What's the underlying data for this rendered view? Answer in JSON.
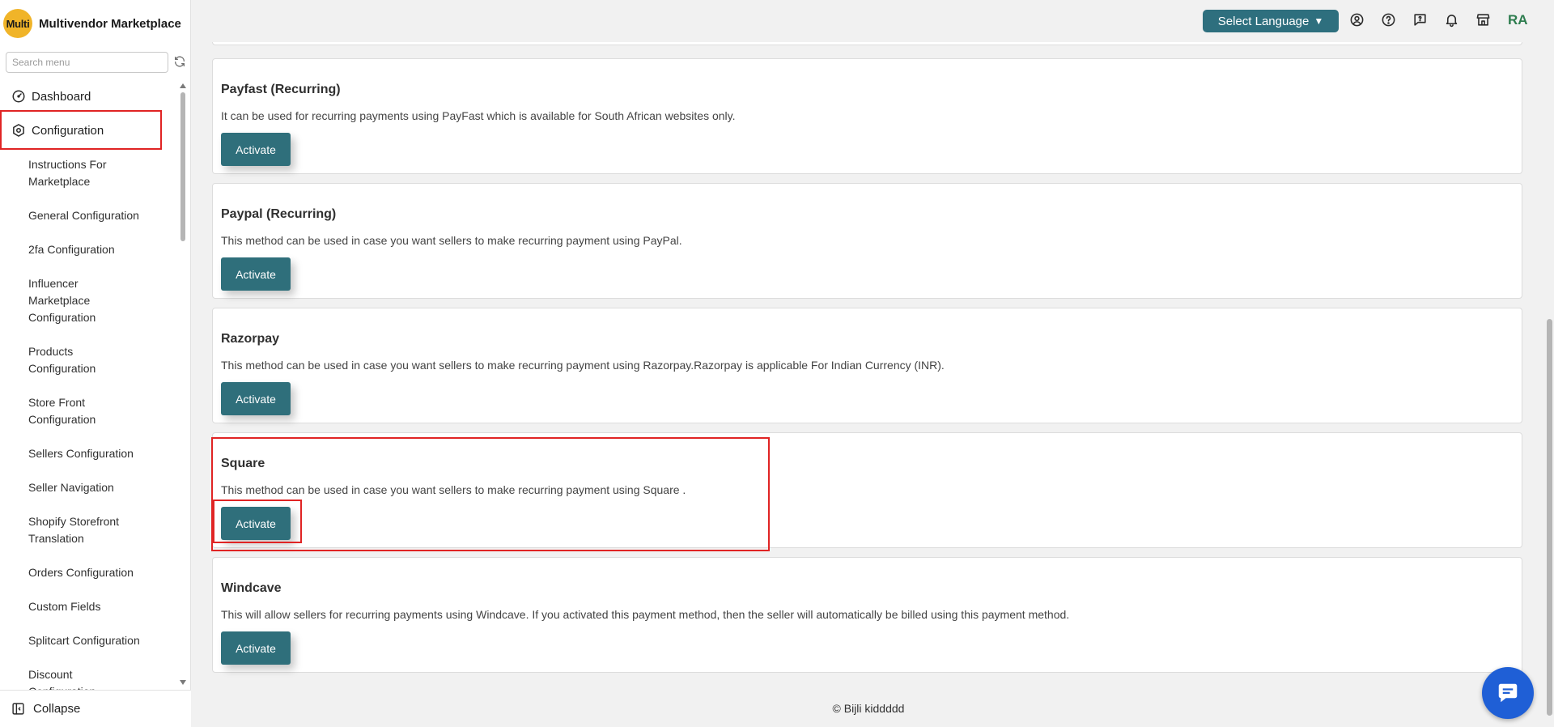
{
  "brand": {
    "logo_text": "Multi",
    "name": "Multivendor Marketplace"
  },
  "search": {
    "placeholder": "Search menu"
  },
  "nav": {
    "dashboard": "Dashboard",
    "configuration": "Configuration",
    "sub_items": [
      "Instructions For Marketplace",
      "General Configuration",
      "2fa Configuration",
      "Influencer Marketplace Configuration",
      "Products Configuration",
      "Store Front Configuration",
      "Sellers Configuration",
      "Seller Navigation",
      "Shopify Storefront Translation",
      "Orders Configuration",
      "Custom Fields",
      "Splitcart Configuration",
      "Discount Configuration"
    ],
    "collapse": "Collapse"
  },
  "topbar": {
    "language_button": "Select Language",
    "avatar": "RA",
    "icons": [
      "user-circle-icon",
      "help-circle-icon",
      "feedback-icon",
      "bell-icon",
      "store-icon"
    ]
  },
  "cards": [
    {
      "title": "Payfast (Recurring)",
      "description": "It can be used for recurring payments using PayFast which is available for South African websites only.",
      "button": "Activate"
    },
    {
      "title": "Paypal (Recurring)",
      "description": "This method can be used in case you want sellers to make recurring payment using PayPal.",
      "button": "Activate"
    },
    {
      "title": "Razorpay",
      "description": "This method can be used in case you want sellers to make recurring payment using Razorpay.Razorpay is applicable For Indian Currency (INR).",
      "button": "Activate"
    },
    {
      "title": "Square",
      "description": "This method can be used in case you want sellers to make recurring payment using Square .",
      "button": "Activate"
    },
    {
      "title": "Windcave",
      "description": "This will allow sellers for recurring payments using Windcave. If you activated this payment method, then the seller will automatically be billed using this payment method.",
      "button": "Activate"
    }
  ],
  "footer": {
    "text": "© Bijli kiddddd"
  },
  "colors": {
    "primary": "#2f6f7b",
    "highlight": "#e02424",
    "chat": "#1f5fd6",
    "logo": "#f0b429"
  }
}
